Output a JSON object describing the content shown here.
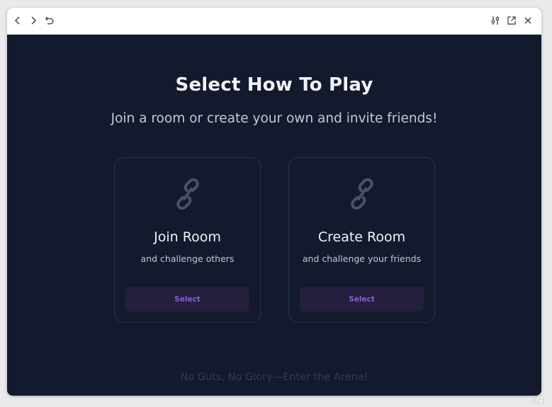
{
  "toolbar": {
    "back_icon": "chevron-left-icon",
    "forward_icon": "chevron-right-icon",
    "reload_icon": "undo-icon",
    "settings_icon": "sliders-icon",
    "popout_icon": "external-link-icon",
    "close_icon": "close-icon"
  },
  "main": {
    "title": "Select How To Play",
    "subtitle": "Join a room or create your own and invite friends!",
    "cards": [
      {
        "icon": "link-icon",
        "title": "Join Room",
        "subtitle": "and challenge others",
        "button_label": "Select"
      },
      {
        "icon": "link-icon",
        "title": "Create Room",
        "subtitle": "and challenge your friends",
        "button_label": "Select"
      }
    ],
    "footer": "No Guts, No Glory—Enter the Arena!"
  },
  "colors": {
    "background": "#141a2e",
    "card_border": "#2a3148",
    "button_bg": "#231f3d",
    "accent": "#8f5ad8"
  },
  "overlay": {
    "corner_text": "Act"
  }
}
